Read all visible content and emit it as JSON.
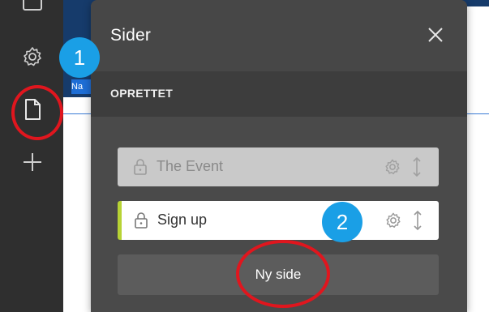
{
  "panel": {
    "title": "Sider",
    "section_label": "OPRETTET",
    "pages": [
      {
        "label": "The Event",
        "state": "disabled"
      },
      {
        "label": "Sign up",
        "state": "active"
      }
    ],
    "new_page_label": "Ny side"
  },
  "background": {
    "nav_tag_text": "Na"
  },
  "annotations": {
    "badge_1": "1",
    "badge_2": "2"
  },
  "colors": {
    "toolbar_bg": "#2f2f2f",
    "panel_bg": "#4a4a4a",
    "badge_blue": "#1a9fe6",
    "annotation_red": "#e0161e",
    "active_accent": "#b7d334"
  },
  "icons": {
    "toolbar": [
      "window-icon",
      "gear-icon",
      "page-icon",
      "plus-icon"
    ],
    "close": "close-icon",
    "lock": "lock-icon",
    "row_gear": "gear-icon",
    "drag": "drag-handle-icon"
  }
}
